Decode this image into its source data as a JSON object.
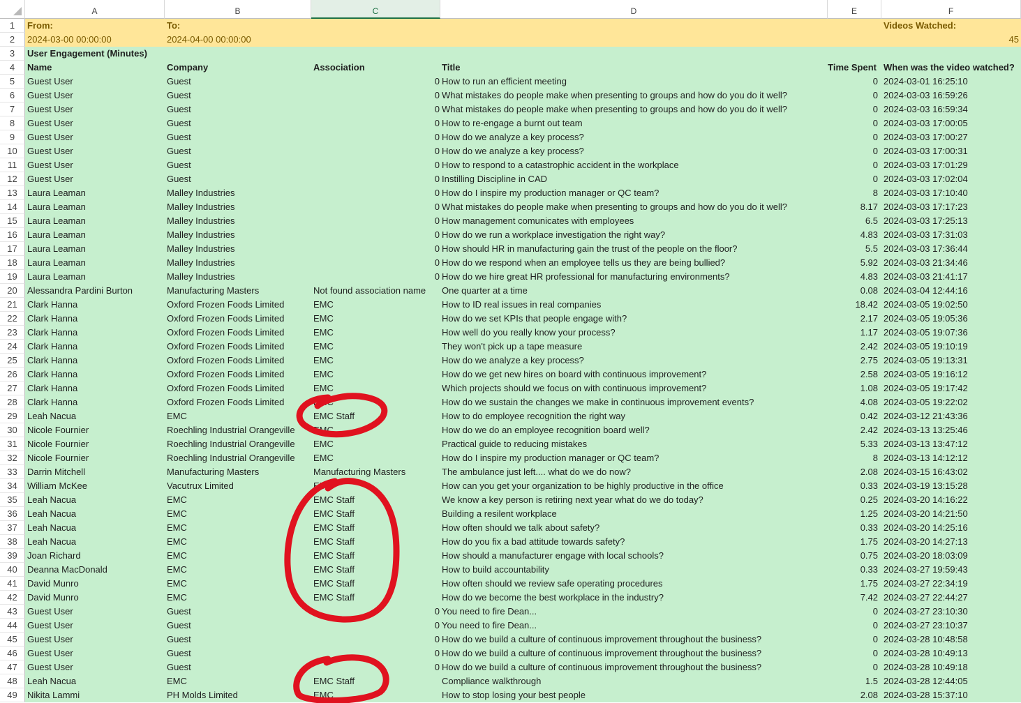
{
  "columns": [
    "A",
    "B",
    "C",
    "D",
    "E",
    "F"
  ],
  "selected_column": "C",
  "header": {
    "from_label": "From:",
    "to_label": "To:",
    "videos_label": "Videos Watched:",
    "from_value": "2024-03-00 00:00:00",
    "to_value": "2024-04-00 00:00:00",
    "videos_value": "45",
    "section_title": "User Engagement (Minutes)"
  },
  "table": {
    "headers": [
      "Name",
      "Company",
      "Association",
      "Title",
      "Time Spent",
      "When was the video watched?"
    ],
    "rows": [
      [
        "Guest User",
        "Guest",
        "0",
        "How to run an efficient meeting",
        "0",
        "2024-03-01 16:25:10"
      ],
      [
        "Guest User",
        "Guest",
        "0",
        "What mistakes do people make when presenting to groups and how do you do it well?",
        "0",
        "2024-03-03 16:59:26"
      ],
      [
        "Guest User",
        "Guest",
        "0",
        "What mistakes do people make when presenting to groups and how do you do it well?",
        "0",
        "2024-03-03 16:59:34"
      ],
      [
        "Guest User",
        "Guest",
        "0",
        "How to re-engage a burnt out team",
        "0",
        "2024-03-03 17:00:05"
      ],
      [
        "Guest User",
        "Guest",
        "0",
        "How do we analyze a key process?",
        "0",
        "2024-03-03 17:00:27"
      ],
      [
        "Guest User",
        "Guest",
        "0",
        "How do we analyze a key process?",
        "0",
        "2024-03-03 17:00:31"
      ],
      [
        "Guest User",
        "Guest",
        "0",
        "How to respond to a catastrophic accident in the workplace",
        "0",
        "2024-03-03 17:01:29"
      ],
      [
        "Guest User",
        "Guest",
        "0",
        "Instilling Discipline in CAD",
        "0",
        "2024-03-03 17:02:04"
      ],
      [
        "Laura Leaman",
        "Malley Industries",
        "0",
        "How do I inspire my production manager or QC team?",
        "8",
        "2024-03-03 17:10:40"
      ],
      [
        "Laura Leaman",
        "Malley Industries",
        "0",
        "What mistakes do people make when presenting to groups and how do you do it well?",
        "8.17",
        "2024-03-03 17:17:23"
      ],
      [
        "Laura Leaman",
        "Malley Industries",
        "0",
        "How management comunicates with employees",
        "6.5",
        "2024-03-03 17:25:13"
      ],
      [
        "Laura Leaman",
        "Malley Industries",
        "0",
        "How do we run a workplace investigation the right way?",
        "4.83",
        "2024-03-03 17:31:03"
      ],
      [
        "Laura Leaman",
        "Malley Industries",
        "0",
        "How should HR in manufacturing gain the trust of the people on the floor?",
        "5.5",
        "2024-03-03 17:36:44"
      ],
      [
        "Laura Leaman",
        "Malley Industries",
        "0",
        "How do we respond when an employee tells us they are being bullied?",
        "5.92",
        "2024-03-03 21:34:46"
      ],
      [
        "Laura Leaman",
        "Malley Industries",
        "0",
        "How do we hire great HR professional for manufacturing environments?",
        "4.83",
        "2024-03-03 21:41:17"
      ],
      [
        "Alessandra Pardini Burton",
        "Manufacturing Masters",
        "Not found association name",
        "One quarter at a time",
        "0.08",
        "2024-03-04 12:44:16"
      ],
      [
        "Clark Hanna",
        "Oxford Frozen Foods Limited",
        "EMC",
        "How to ID real issues in real companies",
        "18.42",
        "2024-03-05 19:02:50"
      ],
      [
        "Clark Hanna",
        "Oxford Frozen Foods Limited",
        "EMC",
        "How do we set KPIs that people engage with?",
        "2.17",
        "2024-03-05 19:05:36"
      ],
      [
        "Clark Hanna",
        "Oxford Frozen Foods Limited",
        "EMC",
        "How well do you really know your process?",
        "1.17",
        "2024-03-05 19:07:36"
      ],
      [
        "Clark Hanna",
        "Oxford Frozen Foods Limited",
        "EMC",
        "They won't pick up a tape measure",
        "2.42",
        "2024-03-05 19:10:19"
      ],
      [
        "Clark Hanna",
        "Oxford Frozen Foods Limited",
        "EMC",
        "How do we analyze a key process?",
        "2.75",
        "2024-03-05 19:13:31"
      ],
      [
        "Clark Hanna",
        "Oxford Frozen Foods Limited",
        "EMC",
        "How do we get new hires on board with continuous improvement?",
        "2.58",
        "2024-03-05 19:16:12"
      ],
      [
        "Clark Hanna",
        "Oxford Frozen Foods Limited",
        "EMC",
        "Which projects should we focus on with continuous improvement?",
        "1.08",
        "2024-03-05 19:17:42"
      ],
      [
        "Clark Hanna",
        "Oxford Frozen Foods Limited",
        "EMC",
        "How do we sustain the changes we make in continuous improvement events?",
        "4.08",
        "2024-03-05 19:22:02"
      ],
      [
        "Leah Nacua",
        "EMC",
        "EMC Staff",
        "How to do employee recognition the right way",
        "0.42",
        "2024-03-12 21:43:36"
      ],
      [
        "Nicole Fournier",
        "Roechling Industrial Orangeville",
        "EMC",
        "How do we do an employee recognition board well?",
        "2.42",
        "2024-03-13 13:25:46"
      ],
      [
        "Nicole Fournier",
        "Roechling Industrial Orangeville",
        "EMC",
        "Practical guide to reducing mistakes",
        "5.33",
        "2024-03-13 13:47:12"
      ],
      [
        "Nicole Fournier",
        "Roechling Industrial Orangeville",
        "EMC",
        "How do I inspire my production manager or QC team?",
        "8",
        "2024-03-13 14:12:12"
      ],
      [
        "Darrin Mitchell",
        "Manufacturing Masters",
        "Manufacturing Masters",
        "The ambulance just left.... what do we do now?",
        "2.08",
        "2024-03-15 16:43:02"
      ],
      [
        "William McKee",
        "Vacutrux Limited",
        "EMC",
        "How can you get your organization to be highly productive in the office",
        "0.33",
        "2024-03-19 13:15:28"
      ],
      [
        "Leah Nacua",
        "EMC",
        "EMC Staff",
        "We know a key person is retiring next year what do we do today?",
        "0.25",
        "2024-03-20 14:16:22"
      ],
      [
        "Leah Nacua",
        "EMC",
        "EMC Staff",
        "Building a resilent workplace",
        "1.25",
        "2024-03-20 14:21:50"
      ],
      [
        "Leah Nacua",
        "EMC",
        "EMC Staff",
        "How often should we talk about safety?",
        "0.33",
        "2024-03-20 14:25:16"
      ],
      [
        "Leah Nacua",
        "EMC",
        "EMC Staff",
        "How do you fix a bad attitude towards safety?",
        "1.75",
        "2024-03-20 14:27:13"
      ],
      [
        "Joan Richard",
        "EMC",
        "EMC Staff",
        "How should a manufacturer engage with local schools?",
        "0.75",
        "2024-03-20 18:03:09"
      ],
      [
        "Deanna MacDonald",
        "EMC",
        "EMC Staff",
        "How to build accountability",
        "0.33",
        "2024-03-27 19:59:43"
      ],
      [
        "David Munro",
        "EMC",
        "EMC Staff",
        "How often should we review safe operating procedures",
        "1.75",
        "2024-03-27 22:34:19"
      ],
      [
        "David Munro",
        "EMC",
        "EMC Staff",
        "How do we become the best workplace in the industry?",
        "7.42",
        "2024-03-27 22:44:27"
      ],
      [
        "Guest User",
        "Guest",
        "0",
        "You need to fire Dean...",
        "0",
        "2024-03-27 23:10:30"
      ],
      [
        "Guest User",
        "Guest",
        "0",
        "You need to fire Dean...",
        "0",
        "2024-03-27 23:10:37"
      ],
      [
        "Guest User",
        "Guest",
        "0",
        "How do we build a culture of continuous improvement throughout the business?",
        "0",
        "2024-03-28 10:48:58"
      ],
      [
        "Guest User",
        "Guest",
        "0",
        "How do we build a culture of continuous improvement throughout the business?",
        "0",
        "2024-03-28 10:49:13"
      ],
      [
        "Guest User",
        "Guest",
        "0",
        "How do we build a culture of continuous improvement throughout the business?",
        "0",
        "2024-03-28 10:49:18"
      ],
      [
        "Leah Nacua",
        "EMC",
        "EMC Staff",
        "Compliance walkthrough",
        "1.5",
        "2024-03-28 12:44:05"
      ],
      [
        "Nikita Lammi",
        "PH Molds Limited",
        "EMC",
        "How to stop losing your best people",
        "2.08",
        "2024-03-28 15:37:10"
      ]
    ]
  },
  "annotation_color": "#e0121f"
}
